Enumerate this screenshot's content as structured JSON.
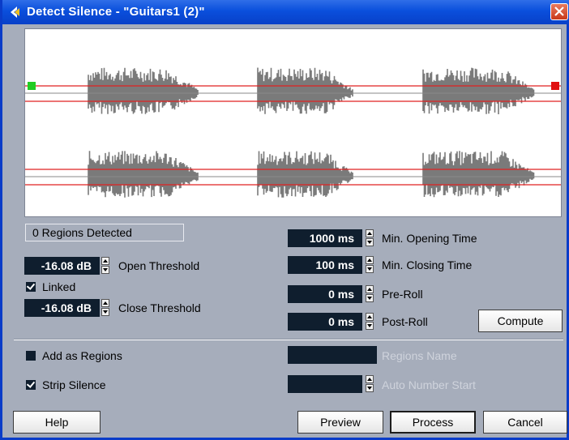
{
  "window": {
    "title": "Detect Silence - \"Guitars1 (2)\"",
    "close_label": "X"
  },
  "status": {
    "regions_detected": "0  Regions Detected"
  },
  "thresholds": {
    "open_value": "-16.08 dB",
    "open_label": "Open Threshold",
    "linked_label": "Linked",
    "linked_checked": true,
    "close_value": "-16.08 dB",
    "close_label": "Close Threshold"
  },
  "timing": {
    "min_opening_value": "1000 ms",
    "min_opening_label": "Min. Opening Time",
    "min_closing_value": "100 ms",
    "min_closing_label": "Min. Closing Time",
    "pre_roll_value": "0 ms",
    "pre_roll_label": "Pre-Roll",
    "post_roll_value": "0 ms",
    "post_roll_label": "Post-Roll"
  },
  "regions": {
    "add_as_regions_label": "Add as Regions",
    "add_as_regions_checked": false,
    "strip_silence_label": "Strip Silence",
    "strip_silence_checked": true,
    "regions_name_label": "Regions Name",
    "auto_number_start_label": "Auto Number Start"
  },
  "buttons": {
    "compute": "Compute",
    "help": "Help",
    "preview": "Preview",
    "process": "Process",
    "cancel": "Cancel"
  },
  "colors": {
    "title_bar": "#0a4fdc",
    "threshold_line": "#e02020",
    "waveform": "#7a7a7a",
    "handle_left": "#22cc22",
    "handle_right": "#e01010"
  }
}
